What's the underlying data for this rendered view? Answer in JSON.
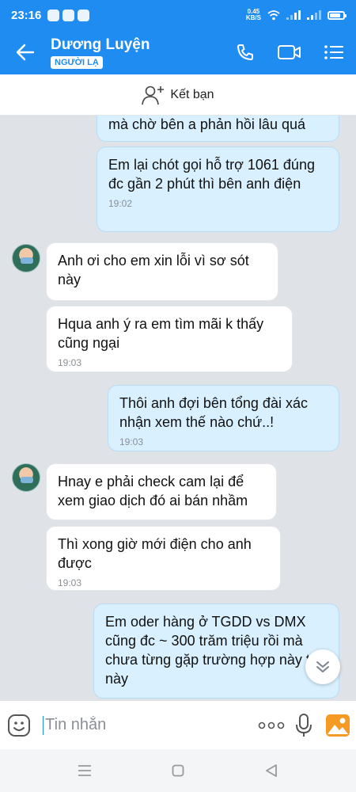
{
  "status_bar": {
    "time": "23:16",
    "net_speed_value": "0.45",
    "net_speed_unit": "KB/S",
    "battery_level": 0.8
  },
  "header": {
    "contact_name": "Dương Luyện",
    "badge": "NGƯỜI LẠ",
    "icons": [
      "back-arrow-icon",
      "phone-icon",
      "video-call-icon",
      "menu-icon"
    ]
  },
  "add_friend": {
    "label": "Kết bạn"
  },
  "messages": [
    {
      "side": "out",
      "text": "mà chờ bên a phản hồi lâu quá",
      "time": ""
    },
    {
      "side": "out",
      "text": "Em lại chót gọi hỗ trợ 1061 đúng đc gần 2 phút thì bên anh điện",
      "time": "19:02"
    },
    {
      "side": "in",
      "text": "Anh ơi cho em xin lỗi vì sơ sót này",
      "time": ""
    },
    {
      "side": "in",
      "text": "Hqua anh ý ra em tìm mãi k thấy cũng ngại",
      "time": "19:03"
    },
    {
      "side": "out",
      "text": "Thôi anh đợi bên tổng đài xác nhận xem thế nào chứ..!",
      "time": "19:03"
    },
    {
      "side": "in",
      "text": "Hnay e phải check cam lại để xem giao dịch đó ai bán nhầm",
      "time": ""
    },
    {
      "side": "in",
      "text": "Thì xong giờ mới điện cho anh được",
      "time": "19:03"
    },
    {
      "side": "out",
      "text": "Em oder hàng ở TGDD vs DMX cũng đc ~ 300 trăm triệu rồi mà chưa từng gặp trường hợp này thế này",
      "time": ""
    }
  ],
  "input": {
    "placeholder": "Tin nhắn"
  },
  "colors": {
    "brand": "#1f8cf2",
    "outgoing_bubble": "#d8f0ff",
    "incoming_bubble": "#ffffff",
    "chat_background": "#dfe3e8"
  }
}
